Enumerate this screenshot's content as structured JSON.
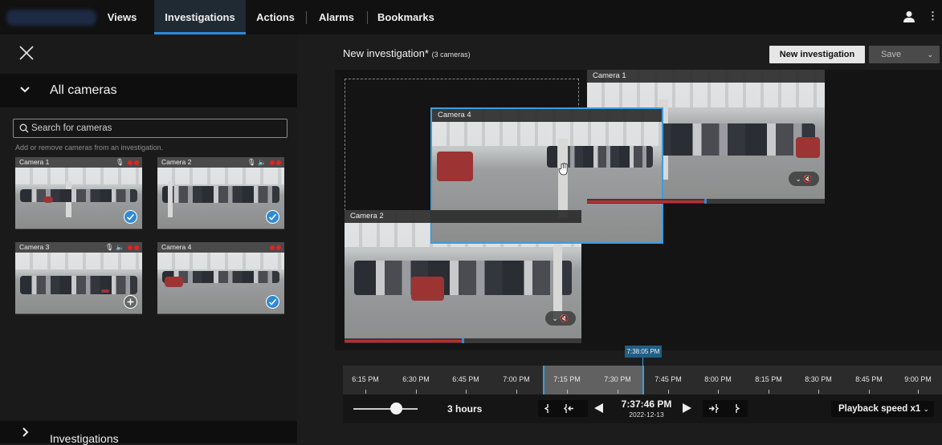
{
  "nav": {
    "tabs": [
      {
        "label": "Views"
      },
      {
        "label": "Investigations"
      },
      {
        "label": "Actions"
      },
      {
        "label": "Alarms"
      },
      {
        "label": "Bookmarks"
      }
    ],
    "active_tab": "Investigations"
  },
  "left_panel": {
    "all_cameras_label": "All cameras",
    "search_placeholder": "Search for cameras",
    "hint": "Add or remove cameras from an investigation.",
    "investigations_label": "Investigations",
    "cameras": [
      {
        "name": "Camera 1",
        "state": "checked"
      },
      {
        "name": "Camera 2",
        "state": "checked"
      },
      {
        "name": "Camera 3",
        "state": "add"
      },
      {
        "name": "Camera 4",
        "state": "checked"
      }
    ]
  },
  "investigation": {
    "title": "New investigation*",
    "camera_count": "(3 cameras)",
    "new_button": "New investigation",
    "save_button": "Save",
    "windows": [
      {
        "name": "Camera 1"
      },
      {
        "name": "Camera 2"
      },
      {
        "name": "Camera 4"
      }
    ]
  },
  "timeline": {
    "marker_time": "7:38:05 PM",
    "labels": [
      "6:15 PM",
      "6:30 PM",
      "6:45 PM",
      "7:00 PM",
      "7:15 PM",
      "7:30 PM",
      "7:45 PM",
      "8:00 PM",
      "8:15 PM",
      "8:30 PM",
      "8:45 PM",
      "9:00 PM"
    ]
  },
  "playback": {
    "span": "3 hours",
    "time": "7:37:46 PM",
    "date": "2022-12-13",
    "speed": "Playback speed x1"
  },
  "colors": {
    "accent": "#2f8ad4",
    "recording": "#e42222",
    "progress": "#c02b2b"
  }
}
